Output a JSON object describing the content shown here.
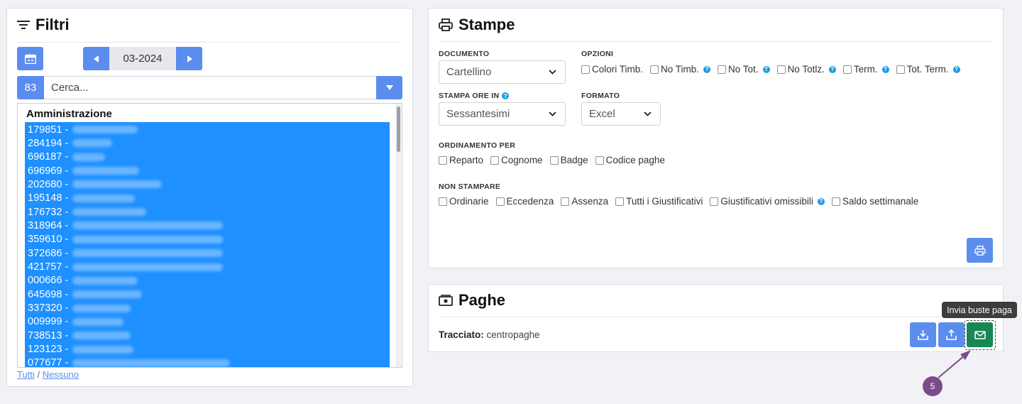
{
  "filtri": {
    "title": "Filtri",
    "month": "03-2024",
    "count": "83",
    "search_placeholder": "Cerca...",
    "group": "Amministrazione",
    "items": [
      {
        "code": "179851 -"
      },
      {
        "code": "284194 -"
      },
      {
        "code": "696187 -"
      },
      {
        "code": "696969 -"
      },
      {
        "code": "202680 -"
      },
      {
        "code": "195148 -"
      },
      {
        "code": "176732 -"
      },
      {
        "code": "318964 -"
      },
      {
        "code": "359610 -"
      },
      {
        "code": "372686 -"
      },
      {
        "code": "421757 -"
      },
      {
        "code": "000666 -"
      },
      {
        "code": "645698 -"
      },
      {
        "code": "337320 -"
      },
      {
        "code": "009999 -"
      },
      {
        "code": "738513 -"
      },
      {
        "code": "123123 -"
      },
      {
        "code": "077677 -"
      }
    ],
    "link_all": "Tutti",
    "link_sep": "/",
    "link_none": "Nessuno"
  },
  "stampe": {
    "title": "Stampe",
    "documento_label": "DOCUMENTO",
    "documento_value": "Cartellino",
    "opzioni_label": "OPZIONI",
    "opzioni": [
      {
        "label": "Colori Timb.",
        "help": false
      },
      {
        "label": "No Timb.",
        "help": true
      },
      {
        "label": "No Tot.",
        "help": true
      },
      {
        "label": "No Totlz.",
        "help": true
      },
      {
        "label": "Term.",
        "help": true
      },
      {
        "label": "Tot. Term.",
        "help": true
      }
    ],
    "stampa_ore_label": "STAMPA ORE IN",
    "stampa_ore_value": "Sessantesimi",
    "formato_label": "FORMATO",
    "formato_value": "Excel",
    "ordinamento_label": "ORDINAMENTO PER",
    "ordinamento": [
      "Reparto",
      "Cognome",
      "Badge",
      "Codice paghe"
    ],
    "non_stampare_label": "NON STAMPARE",
    "non_stampare": [
      {
        "label": "Ordinarie",
        "help": false
      },
      {
        "label": "Eccedenza",
        "help": false
      },
      {
        "label": "Assenza",
        "help": false
      },
      {
        "label": "Tutti i Giustificativi",
        "help": false
      },
      {
        "label": "Giustificativi omissibili",
        "help": true
      },
      {
        "label": "Saldo settimanale",
        "help": false
      }
    ],
    "help_glyph": "?"
  },
  "paghe": {
    "title": "Paghe",
    "tracciato_label": "Tracciato:",
    "tracciato_value": "centropaghe",
    "tooltip": "Invia buste paga"
  },
  "step_marker": "5",
  "colors": {
    "primary": "#5b8def",
    "selection": "#1e90ff",
    "success": "#198754",
    "help": "#1e9be0",
    "marker": "#7b4a88"
  }
}
